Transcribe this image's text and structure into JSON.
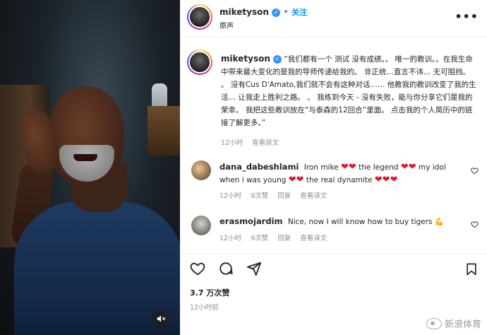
{
  "post": {
    "username": "miketyson",
    "verified_glyph": "✓",
    "separator": "•",
    "follow_label": "关注",
    "audio_label": "原声",
    "more_glyph": "•••"
  },
  "caption": {
    "username": "miketyson",
    "text": "“我们都有一个 测试 没有成绩。。 唯一的教训。。在我生命中带来最大变化的是我的导师传递给我的。 非正统…直言不讳… 无可阻挡。 。 没有Cus D'Amato,我们就不会有这种对话…… 他教我的教训改变了我的生活… 让我走上胜利之路。 。 我练到今天 - 没有失败，能与你分享它们是我的荣幸。 我把这些教训放在“与泰森的12回合”里面。 点击我的个人简历中的链接了解更多。”",
    "time": "12小时",
    "see_translation": "查看原文"
  },
  "comments": [
    {
      "username": "dana_dabeshlami",
      "parts": [
        "Iron mike",
        "the legend",
        "my idol",
        "when i was young",
        "the real dynamite"
      ],
      "time": "12小时",
      "likes": "9次赞",
      "reply": "回复",
      "see_translation": "查看译文"
    },
    {
      "username": "erasmojardim",
      "text": "Nice, now I will know how to buy tigers",
      "emoji": "💪",
      "time": "12小时",
      "likes": "9次赞",
      "reply": "回复",
      "see_translation": "查看译文"
    }
  ],
  "stats": {
    "likes": "3.7 万次赞",
    "posted": "12小时前"
  },
  "watermark": {
    "text": "新浪体育"
  },
  "icons": {
    "mute": "speaker-muted-icon",
    "like": "heart-icon",
    "comment": "comment-icon",
    "share": "paper-plane-icon",
    "save": "bookmark-icon",
    "more": "ellipsis-icon",
    "verified": "verified-badge-icon"
  },
  "colors": {
    "accent": "#0095f6",
    "verified": "#3897f0",
    "heart": "#e0182d",
    "muted_text": "#8e8e8e"
  }
}
